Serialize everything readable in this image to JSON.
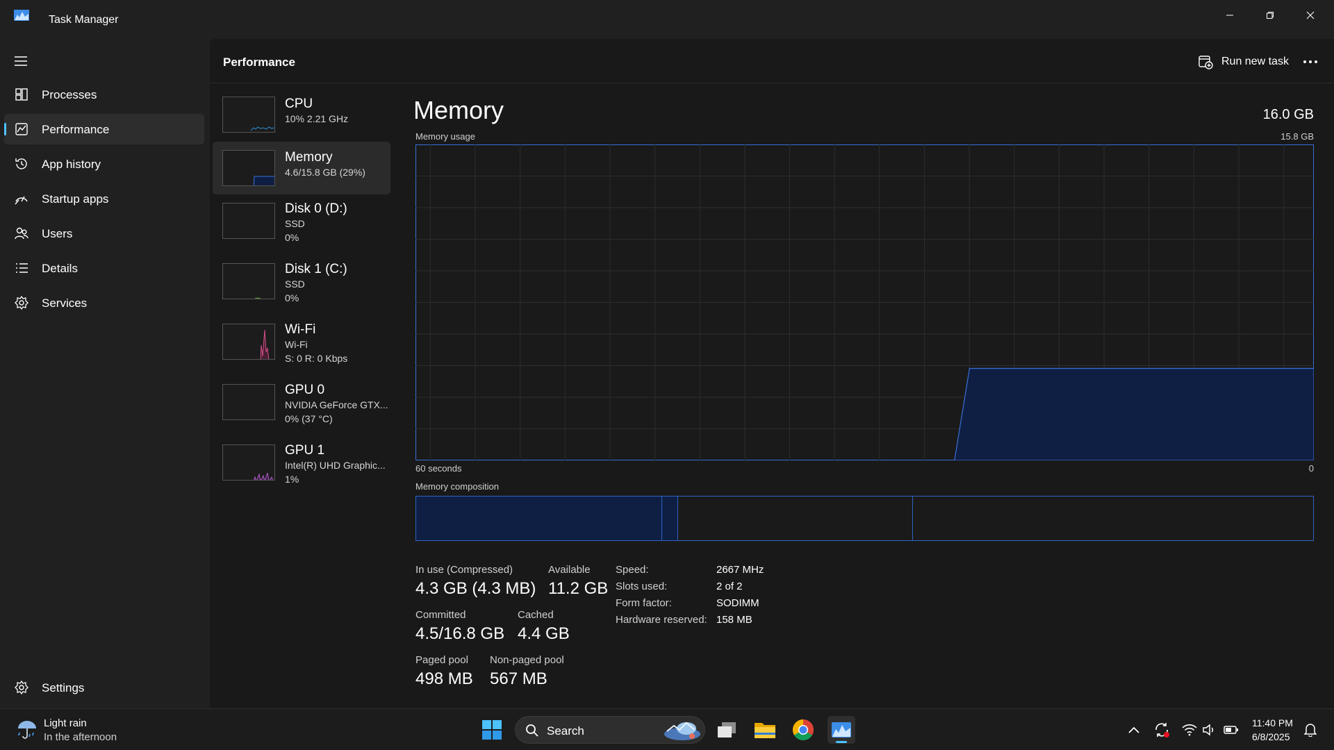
{
  "window": {
    "title": "Task Manager"
  },
  "nav": {
    "items": [
      {
        "label": "Processes",
        "icon": "processes-icon"
      },
      {
        "label": "Performance",
        "icon": "performance-icon",
        "active": true
      },
      {
        "label": "App history",
        "icon": "history-icon"
      },
      {
        "label": "Startup apps",
        "icon": "startup-icon"
      },
      {
        "label": "Users",
        "icon": "users-icon"
      },
      {
        "label": "Details",
        "icon": "details-icon"
      },
      {
        "label": "Services",
        "icon": "services-icon"
      }
    ],
    "settings_label": "Settings"
  },
  "header": {
    "title": "Performance",
    "run_task_label": "Run new task"
  },
  "devices": [
    {
      "name": "CPU",
      "line1": "10%  2.21 GHz",
      "line2": "",
      "color": "#2b8fd6"
    },
    {
      "name": "Memory",
      "line1": "4.6/15.8 GB (29%)",
      "line2": "",
      "color": "#3a6fd8",
      "active": true
    },
    {
      "name": "Disk 0 (D:)",
      "line1": "SSD",
      "line2": "0%",
      "color": "#6cb33f"
    },
    {
      "name": "Disk 1 (C:)",
      "line1": "SSD",
      "line2": "0%",
      "color": "#6cb33f"
    },
    {
      "name": "Wi-Fi",
      "line1": "Wi-Fi",
      "line2": "S: 0  R: 0 Kbps",
      "color": "#d64f8b"
    },
    {
      "name": "GPU 0",
      "line1": "NVIDIA GeForce GTX...",
      "line2": "0%  (37 °C)",
      "color": "#b05cc9"
    },
    {
      "name": "GPU 1",
      "line1": "Intel(R) UHD Graphic...",
      "line2": "1%",
      "color": "#b05cc9"
    }
  ],
  "memory": {
    "title": "Memory",
    "total": "16.0 GB",
    "usage_label": "Memory usage",
    "usage_max": "15.8 GB",
    "time_left": "60 seconds",
    "time_right": "0",
    "composition_label": "Memory composition",
    "composition": [
      {
        "name": "in-use",
        "fraction": 0.274,
        "filled": true
      },
      {
        "name": "modified",
        "fraction": 0.018,
        "filled": true
      },
      {
        "name": "standby",
        "fraction": 0.262,
        "filled": false
      },
      {
        "name": "free",
        "fraction": 0.446,
        "filled": false
      }
    ],
    "stats": {
      "in_use_label": "In use (Compressed)",
      "in_use_value": "4.3 GB (4.3 MB)",
      "available_label": "Available",
      "available_value": "11.2 GB",
      "committed_label": "Committed",
      "committed_value": "4.5/16.8 GB",
      "cached_label": "Cached",
      "cached_value": "4.4 GB",
      "paged_label": "Paged pool",
      "paged_value": "498 MB",
      "nonpaged_label": "Non-paged pool",
      "nonpaged_value": "567 MB"
    },
    "specs": [
      {
        "label": "Speed:",
        "value": "2667 MHz"
      },
      {
        "label": "Slots used:",
        "value": "2 of 2"
      },
      {
        "label": "Form factor:",
        "value": "SODIMM"
      },
      {
        "label": "Hardware reserved:",
        "value": "158 MB"
      }
    ]
  },
  "chart_data": {
    "type": "area",
    "x": [
      60,
      59,
      58,
      57,
      56,
      55,
      54,
      53,
      52,
      51,
      50,
      49,
      48,
      47,
      46,
      45,
      44,
      43,
      42,
      41,
      40,
      39,
      38,
      37,
      36,
      35,
      34,
      33,
      32,
      31,
      30,
      29,
      28,
      27,
      26,
      25,
      24,
      23,
      22,
      21,
      20,
      19,
      18,
      17,
      16,
      15,
      14,
      13,
      12,
      11,
      10,
      9,
      8,
      7,
      6,
      5,
      4,
      3,
      2,
      1,
      0
    ],
    "values": [
      null,
      null,
      null,
      null,
      null,
      null,
      null,
      null,
      null,
      null,
      null,
      null,
      null,
      null,
      null,
      null,
      null,
      null,
      null,
      null,
      null,
      null,
      null,
      null,
      null,
      null,
      null,
      null,
      null,
      null,
      null,
      null,
      null,
      null,
      null,
      null,
      0,
      4.6,
      4.6,
      4.6,
      4.6,
      4.6,
      4.6,
      4.6,
      4.6,
      4.6,
      4.6,
      4.6,
      4.6,
      4.6,
      4.6,
      4.6,
      4.6,
      4.6,
      4.6,
      4.6,
      4.6,
      4.6,
      4.6,
      4.6,
      4.6
    ],
    "xlabel": "",
    "ylabel": "",
    "xlim": [
      60,
      0
    ],
    "ylim": [
      0,
      15.8
    ],
    "grid": true,
    "line_color": "#3a6fd8",
    "fill_color": "#0f1f44"
  },
  "taskbar": {
    "weather_main": "Light rain",
    "weather_sub": "In the afternoon",
    "search_label": "Search",
    "time": "11:40 PM",
    "date": "6/8/2025"
  }
}
